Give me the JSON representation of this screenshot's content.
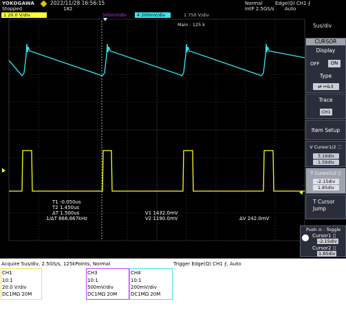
{
  "header": {
    "brand": "YOKOGAWA",
    "status": "Stopped",
    "datetime": "2022/11/28 16:56:15",
    "record": "182",
    "acq_mode": "Normal",
    "sample_rate": "IntP 2.5GS/s",
    "trigger": "Edge(Q) CH1 ⨍",
    "trigger_mode": "Auto",
    "channels": [
      {
        "label": "1 20.0 V/div",
        "color": "#ffff33"
      },
      {
        "label": "500mV/div",
        "color": "#c040ff"
      },
      {
        "label": "4 200mV/div",
        "color": "#33e8f0"
      },
      {
        "label": "1 750 V/div",
        "color": "#c8c8c8"
      }
    ],
    "timebase": "5us/div",
    "main_label": "Main : 125 k"
  },
  "menu": {
    "title": "CURSOR",
    "display_label": "Display",
    "display_off": "OFF",
    "display_on": "ON",
    "type_label": "Type",
    "type_value": "⇄ ↔&↕",
    "trace_label": "Trace",
    "trace_value": "CH1",
    "item_setup": "Item Setup",
    "vcursor_label": "V Cursor1/2 ⁚⁚⁚",
    "vcursor_1": "3.16div",
    "vcursor_2": "1.56div",
    "tcursor_label": "T Cursor1/2 ¦¦",
    "tcursor_1": "-2.15div",
    "tcursor_2": "1.85div",
    "tcursor_jump": "T Cursor Jump",
    "push_toggle": "Push ⊙ : Toggle",
    "knob1_label": "Cursor1 ¦¦",
    "knob1_value": "-2.15div",
    "knob2_label": "Cursor2 ¦¦",
    "knob2_value": "1.85div"
  },
  "readouts": {
    "t1": "T1  -0.050us",
    "t2": "T2   1.450us",
    "dt": "ΔT   1.500us",
    "inv_dt": "1/ΔT  666.667kHz",
    "v1": "V1   1432.0mV",
    "v2": "V2   1190.0mV",
    "dv": "ΔV   242.0mV"
  },
  "info": {
    "acquire": "Acquire 5us/div, 2.5GS/s, 125kPoints, Normal",
    "trigger": "Trigger Edge(Q) CH1 ⨍, Auto",
    "ch1": {
      "title": "CH1",
      "probe": "10:1",
      "scale": "20.0 V/div",
      "coupling": "DC1MΩ 20M",
      "color": "#f0e060"
    },
    "ch3": {
      "title": "CH3",
      "probe": "10:1",
      "scale": "500mV/div",
      "coupling": "DC1MΩ 20M",
      "color": "#c040ff"
    },
    "ch4": {
      "title": "CH4",
      "probe": "10:1",
      "scale": "200mV/div",
      "coupling": "DC1MΩ 20M",
      "color": "#33e8f0"
    }
  },
  "colors": {
    "ch1_trace": "#ffff22",
    "ch4_trace": "#33e0ee",
    "grid": "#5a5a5a"
  }
}
